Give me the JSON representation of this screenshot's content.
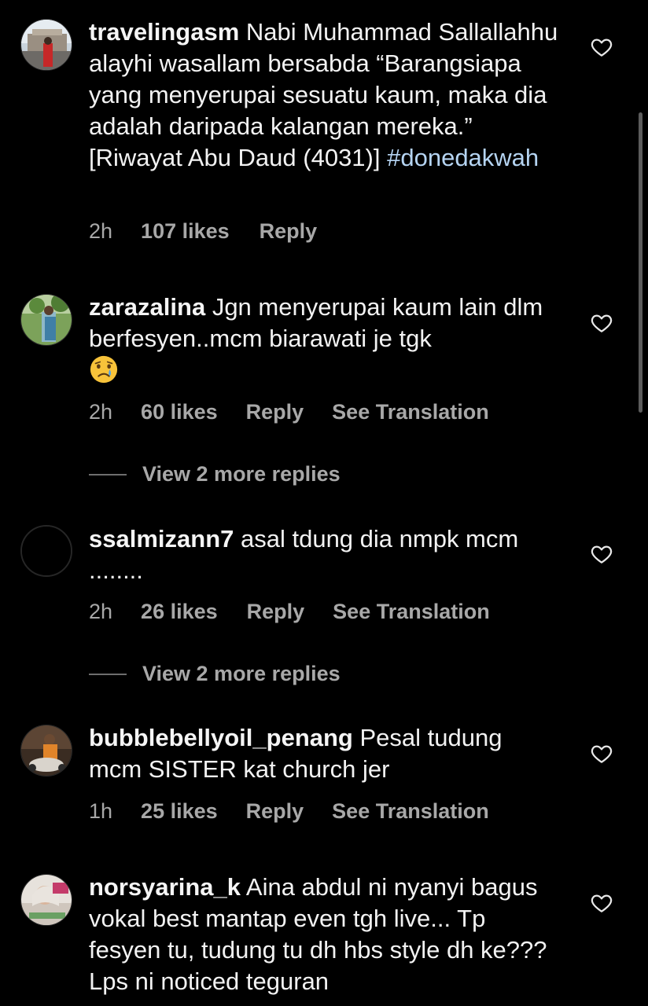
{
  "comments": [
    {
      "username": "travelingasm",
      "text": " Nabi Muhammad Sallallahhu alayhi wasallam bersabda “Barangsiapa yang menyerupai sesuatu kaum, maka dia adalah daripada kalangan mereka.” [Riwayat Abu Daud (4031)] ",
      "hashtag": "#donedakwah",
      "time": "2h",
      "likes": "107 likes",
      "reply": "Reply",
      "avatar_icon": "photo-avatar"
    },
    {
      "username": "zarazalina",
      "text": " Jgn menyerupai kaum lain dlm berfesyen..mcm biarawati je tgk",
      "emoji": "crying-face-emoji",
      "time": "2h",
      "likes": "60 likes",
      "reply": "Reply",
      "translate": "See Translation",
      "view_replies": "View 2 more replies",
      "avatar_icon": "photo-avatar"
    },
    {
      "username": "ssalmizann7",
      "text": " asal tdung dia nmpk mcm ........",
      "time": "2h",
      "likes": "26 likes",
      "reply": "Reply",
      "translate": "See Translation",
      "view_replies": "View 2 more replies",
      "avatar_icon": "empty-avatar"
    },
    {
      "username": "bubblebellyoil_penang",
      "text": " Pesal tudung mcm SISTER kat church jer",
      "time": "1h",
      "likes": "25 likes",
      "reply": "Reply",
      "translate": "See Translation",
      "avatar_icon": "photo-avatar"
    },
    {
      "username": "norsyarina_k",
      "text": " Aina abdul ni nyanyi bagus vokal best mantap even tgh live... Tp fesyen tu, tudung tu dh hbs style dh ke??? Lps ni noticed teguran",
      "avatar_icon": "photo-avatar"
    }
  ],
  "icons": {
    "like": "heart-outline-icon"
  },
  "colors": {
    "background": "#000000",
    "text": "#f2f2f2",
    "secondary": "#a8a8a8",
    "hashtag": "#b5d4f2"
  }
}
